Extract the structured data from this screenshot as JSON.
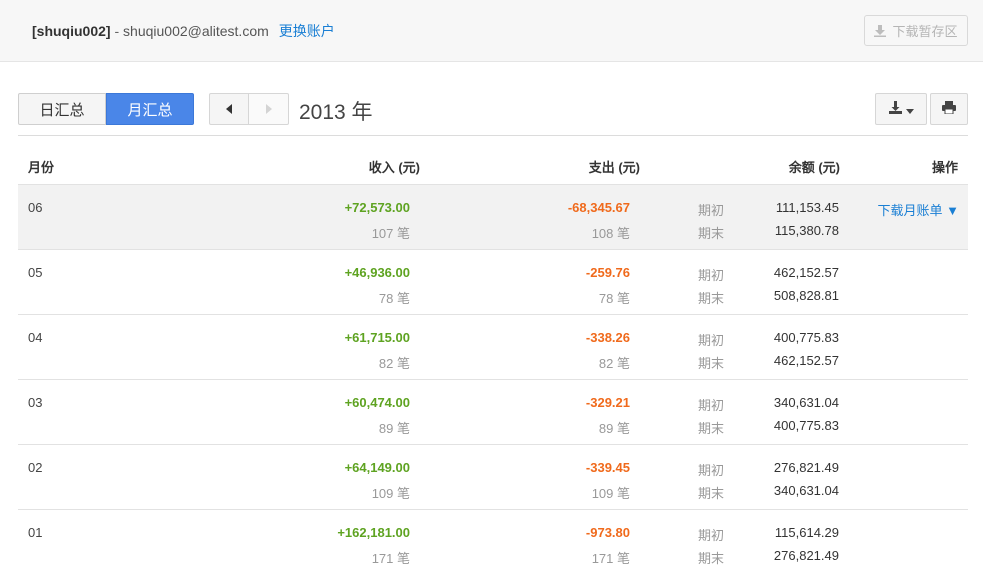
{
  "header": {
    "username": "[shuqiu002]",
    "separator": " - ",
    "email": "shuqiu002@alitest.com",
    "switch_account": "更换账户",
    "download_temp": "下载暂存区"
  },
  "toolbar": {
    "tab_daily": "日汇总",
    "tab_monthly": "月汇总",
    "active_tab": "月汇总",
    "year_label": "2013 年"
  },
  "table": {
    "columns": {
      "month": "月份",
      "income": "收入 (元)",
      "expense": "支出 (元)",
      "balance": "余额 (元)",
      "action": "操作"
    },
    "rows": [
      {
        "month": "06",
        "income": "+72,573.00",
        "income_count": "107 笔",
        "expense": "-68,345.67",
        "expense_count": "108 笔",
        "start_label": "期初",
        "start_balance": "111,153.45",
        "end_label": "期末",
        "end_balance": "115,380.78",
        "action": "下载月账单 ▼"
      },
      {
        "month": "05",
        "income": "+46,936.00",
        "income_count": "78 笔",
        "expense": "-259.76",
        "expense_count": "78 笔",
        "start_label": "期初",
        "start_balance": "462,152.57",
        "end_label": "期末",
        "end_balance": "508,828.81",
        "action": ""
      },
      {
        "month": "04",
        "income": "+61,715.00",
        "income_count": "82 笔",
        "expense": "-338.26",
        "expense_count": "82 笔",
        "start_label": "期初",
        "start_balance": "400,775.83",
        "end_label": "期末",
        "end_balance": "462,152.57",
        "action": ""
      },
      {
        "month": "03",
        "income": "+60,474.00",
        "income_count": "89 笔",
        "expense": "-329.21",
        "expense_count": "89 笔",
        "start_label": "期初",
        "start_balance": "340,631.04",
        "end_label": "期末",
        "end_balance": "400,775.83",
        "action": ""
      },
      {
        "month": "02",
        "income": "+64,149.00",
        "income_count": "109 笔",
        "expense": "-339.45",
        "expense_count": "109 笔",
        "start_label": "期初",
        "start_balance": "276,821.49",
        "end_label": "期末",
        "end_balance": "340,631.04",
        "action": ""
      },
      {
        "month": "01",
        "income": "+162,181.00",
        "income_count": "171 笔",
        "expense": "-973.80",
        "expense_count": "171 笔",
        "start_label": "期初",
        "start_balance": "115,614.29",
        "end_label": "期末",
        "end_balance": "276,821.49",
        "action": ""
      }
    ]
  },
  "icons": {
    "download_temp": "download-tray-icon",
    "prev": "caret-left-icon",
    "next": "caret-right-icon",
    "download": "download-icon",
    "dropdown": "caret-down-icon",
    "print": "printer-icon"
  },
  "colors": {
    "accent": "#4a86e8",
    "link": "#1a7fd4",
    "income": "#5ea321",
    "expense": "#f06a1c",
    "highlight_row": "#f2f2f2"
  }
}
